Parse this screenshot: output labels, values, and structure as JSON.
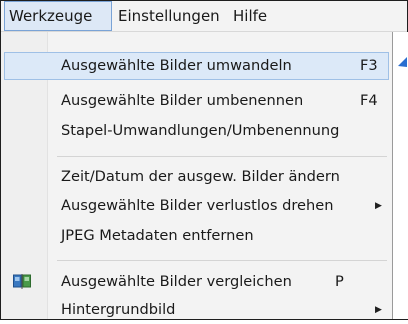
{
  "menubar": {
    "items": [
      {
        "label": "Werkzeuge"
      },
      {
        "label": "Einstellungen"
      },
      {
        "label": "Hilfe"
      }
    ]
  },
  "menu": {
    "items": [
      {
        "label": "Ausgewählte Bilder umwandeln",
        "shortcut": "F3"
      },
      {
        "label": "Ausgewählte Bilder umbenennen",
        "shortcut": "F4"
      },
      {
        "label": "Stapel-Umwandlungen/Umbenennung"
      },
      {
        "label": "Zeit/Datum der ausgew. Bilder ändern"
      },
      {
        "label": "Ausgewählte Bilder verlustlos drehen",
        "submenu_icon": "submenu-arrow-icon"
      },
      {
        "label": "JPEG Metadaten entfernen"
      },
      {
        "label": "Ausgewählte Bilder vergleichen",
        "shortcut": "P",
        "icon": "compare-images-icon"
      },
      {
        "label": "Hintergrundbild",
        "submenu_icon": "submenu-arrow-icon"
      }
    ]
  },
  "colors": {
    "highlight": "#dce9f8",
    "highlight_border": "#9fc0e6",
    "menu_background": "#f3f3f3",
    "icon_blue": "#3a78c0",
    "icon_green": "#4a9a4a"
  }
}
